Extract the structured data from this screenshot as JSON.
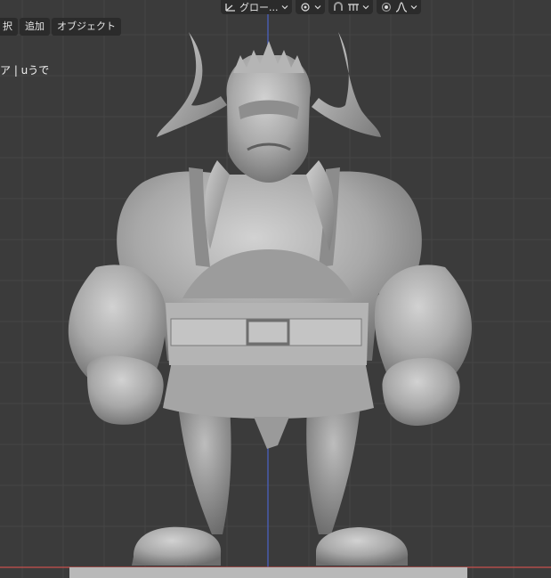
{
  "header": {
    "orientation_label": "グロー...",
    "icons": [
      "transform-orientation-icon",
      "pivot-point-icon",
      "snap-magnet-icon",
      "snap-increment-icon",
      "proportional-editing-icon",
      "falloff-curve-icon"
    ]
  },
  "menu": {
    "items": [
      {
        "label": "択"
      },
      {
        "label": "追加"
      },
      {
        "label": "オブジェクト"
      }
    ]
  },
  "viewport": {
    "object_label": "ア | uうで",
    "model": "orc-sculpt"
  },
  "colors": {
    "viewport_bg": "#3b3b3b",
    "grid_line": "#464646",
    "z_axis": "#4a63c8",
    "x_axis": "#c8504c",
    "header_bg": "#2b2b2b",
    "model_base": "#a9a9a9"
  }
}
